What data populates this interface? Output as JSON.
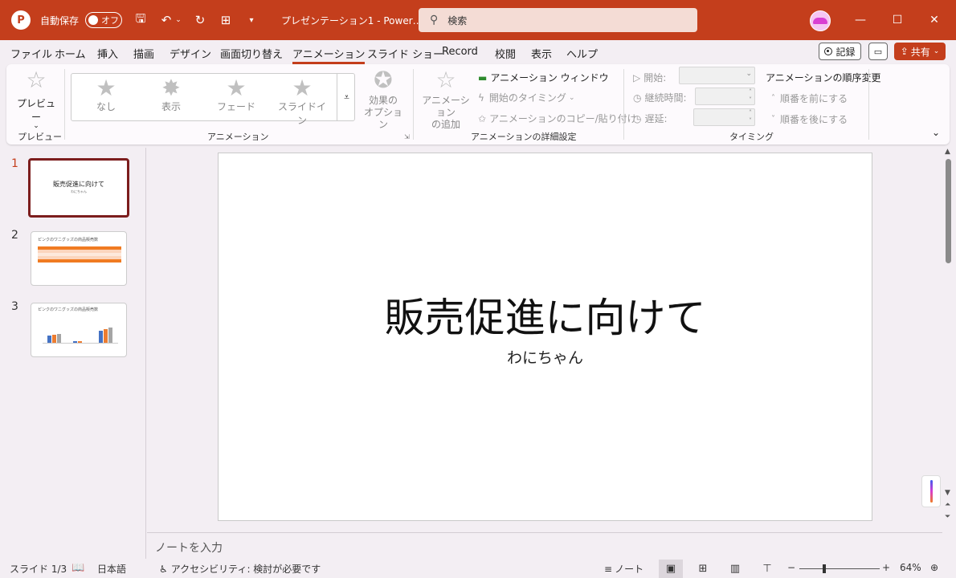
{
  "titlebar": {
    "autosave_label": "自動保存",
    "autosave_state": "オフ",
    "filename": "プレゼンテーション1 - Power…",
    "search_placeholder": "検索"
  },
  "menu": {
    "tabs": [
      "ファイル",
      "ホーム",
      "挿入",
      "描画",
      "デザイン",
      "画面切り替え",
      "アニメーション",
      "スライド ショー",
      "Record",
      "校閲",
      "表示",
      "ヘルプ"
    ],
    "active": "アニメーション",
    "record_label": "記録",
    "share_label": "共有"
  },
  "ribbon": {
    "preview_label": "プレビュー",
    "preview_group": "プレビュー",
    "gallery": [
      "なし",
      "表示",
      "フェード",
      "スライドイン"
    ],
    "effect_options_line1": "効果の",
    "effect_options_line2": "オプション",
    "animation_group": "アニメーション",
    "add_animation_line1": "アニメーション",
    "add_animation_line2": "の追加",
    "animation_pane": "アニメーション ウィンドウ",
    "trigger": "開始のタイミング",
    "anim_painter": "アニメーションのコピー/貼り付け",
    "advanced_group": "アニメーションの詳細設定",
    "start_label": "開始:",
    "duration_label": "継続時間:",
    "delay_label": "遅延:",
    "timing_group": "タイミング",
    "reorder_title": "アニメーションの順序変更",
    "move_earlier": "順番を前にする",
    "move_later": "順番を後にする"
  },
  "slides": {
    "numbers": [
      "1",
      "2",
      "3"
    ],
    "thumb1_title": "販売促進に向けて",
    "thumb1_sub": "わにちゃん",
    "thumb2_title": "ピンクのワニグッズの商品販売数",
    "thumb3_title": "ピンクのワニグッズの商品販売数"
  },
  "slide": {
    "title": "販売促進に向けて",
    "subtitle": "わにちゃん"
  },
  "notes_placeholder": "ノートを入力",
  "status": {
    "slide_pos": "スライド 1/3",
    "language": "日本語",
    "accessibility": "アクセシビリティ: 検討が必要です",
    "notes_btn": "ノート",
    "zoom": "64%"
  },
  "colors": {
    "accent": "#c43e1c",
    "selected_thumb_border": "#7c1d1d"
  }
}
